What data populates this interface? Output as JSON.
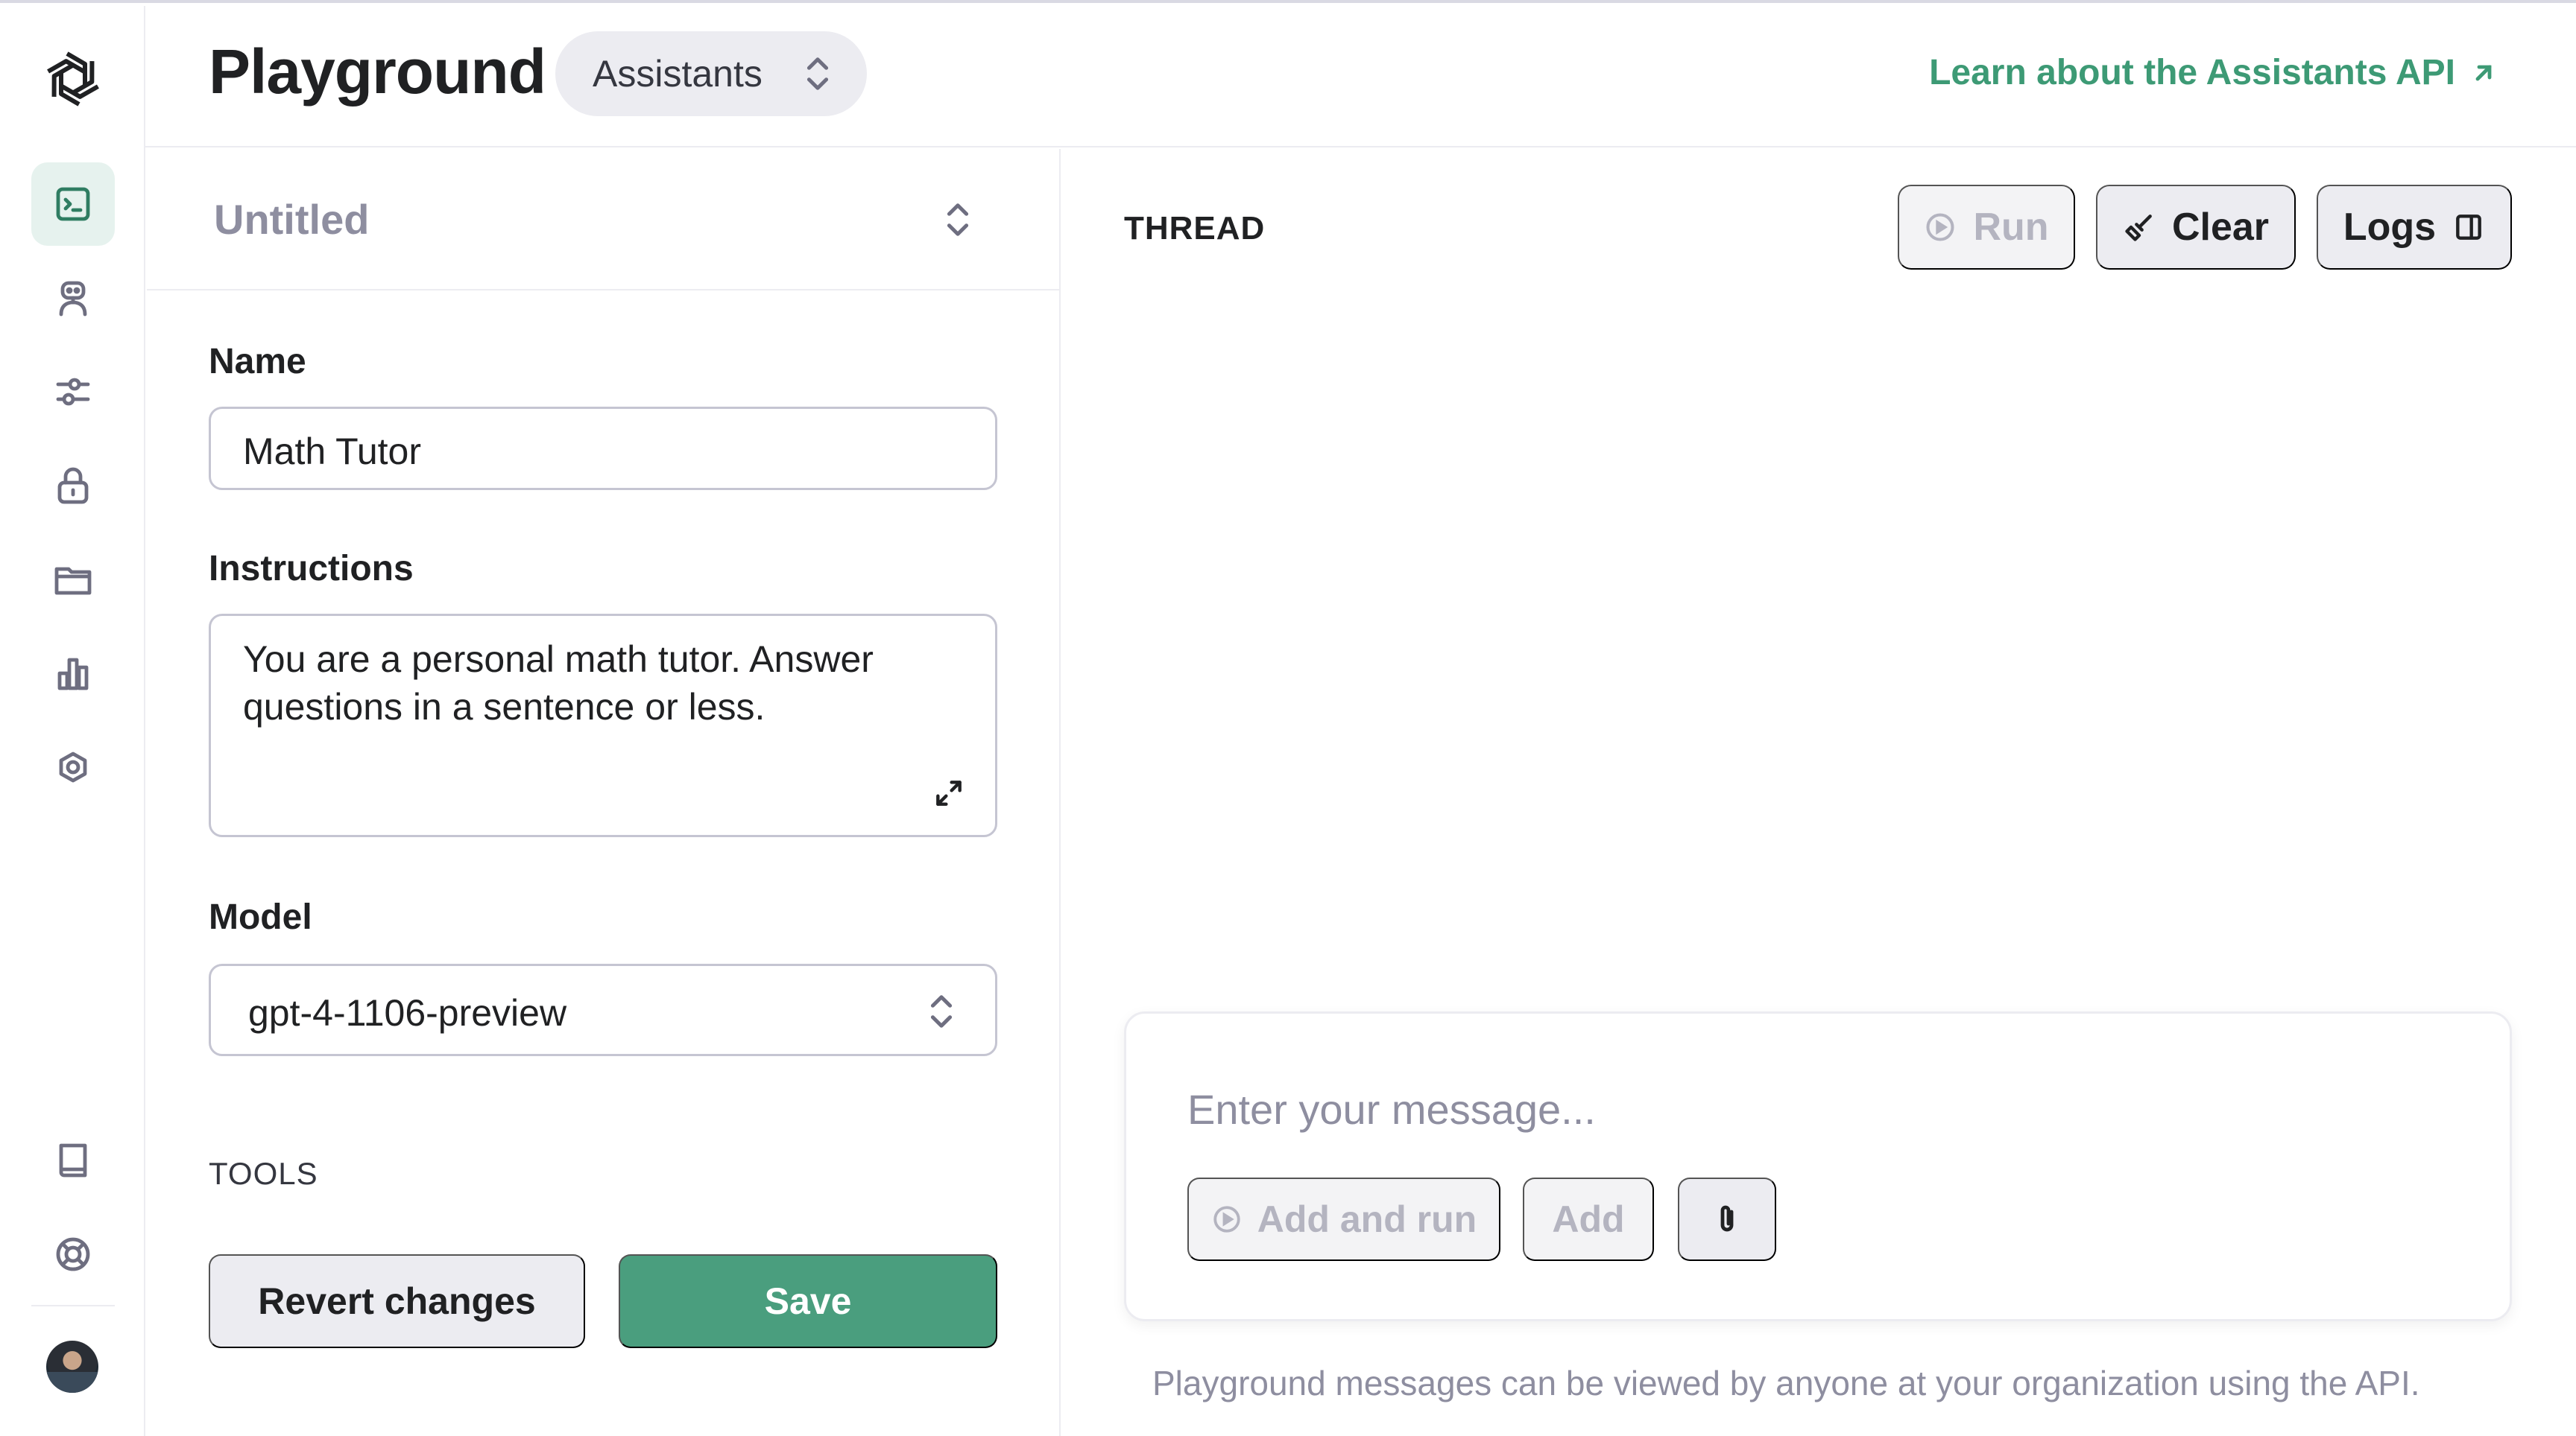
{
  "header": {
    "title": "Playground",
    "mode": "Assistants",
    "learn_link": "Learn about the Assistants API"
  },
  "sidebar": {
    "items": [
      {
        "icon": "terminal-icon",
        "active": true
      },
      {
        "icon": "robot-icon",
        "active": false
      },
      {
        "icon": "sliders-icon",
        "active": false
      },
      {
        "icon": "lock-icon",
        "active": false
      },
      {
        "icon": "folder-icon",
        "active": false
      },
      {
        "icon": "bar-chart-icon",
        "active": false
      },
      {
        "icon": "gear-icon",
        "active": false
      }
    ],
    "bottom_items": [
      {
        "icon": "book-icon"
      },
      {
        "icon": "help-lifebuoy-icon"
      }
    ]
  },
  "assistant": {
    "name": "Untitled",
    "name_label": "Name",
    "name_value": "Math Tutor",
    "instructions_label": "Instructions",
    "instructions_value": "You are a personal math tutor. Answer questions in a sentence or less.",
    "model_label": "Model",
    "model_value": "gpt-4-1106-preview",
    "tools_label": "TOOLS",
    "revert_label": "Revert changes",
    "save_label": "Save"
  },
  "thread": {
    "label": "THREAD",
    "run_label": "Run",
    "clear_label": "Clear",
    "logs_label": "Logs",
    "message_placeholder": "Enter your message...",
    "add_and_run_label": "Add and run",
    "add_label": "Add",
    "footer_note": "Playground messages can be viewed by anyone at your organization using the API."
  },
  "colors": {
    "accent": "#4a9e7e",
    "link": "#3d9a75",
    "active_nav_bg": "#e6f2ee",
    "button_bg": "#ececf1",
    "muted_text": "#8e8ea0"
  }
}
